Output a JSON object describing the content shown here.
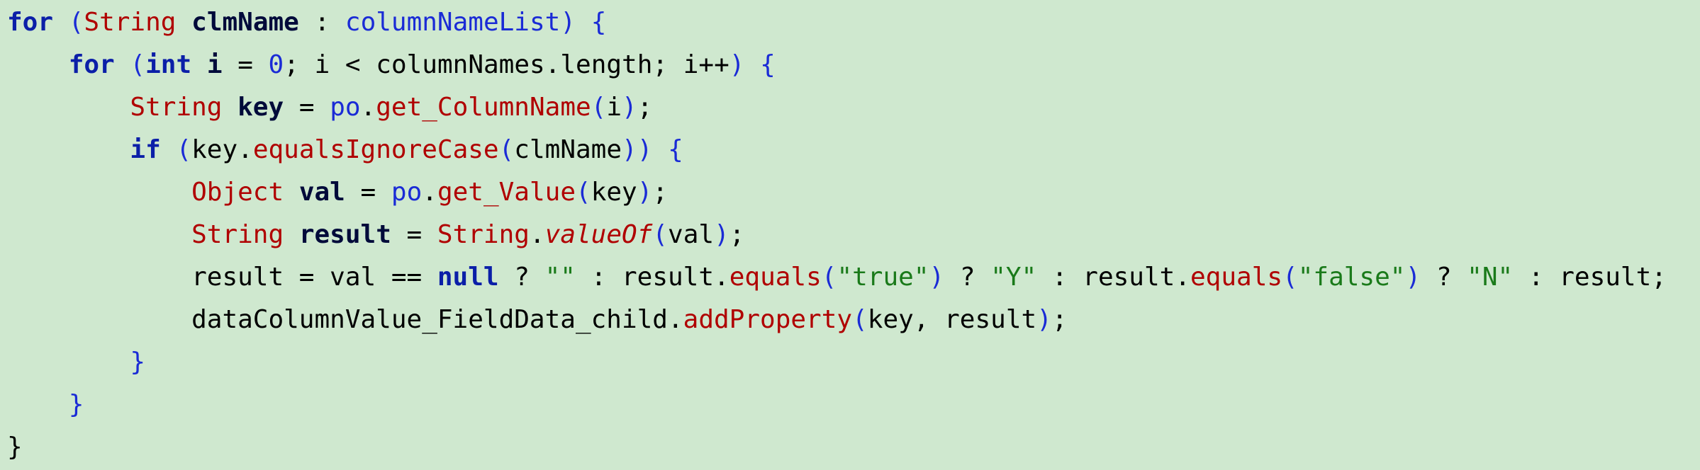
{
  "editor": {
    "lines": [
      [
        {
          "t": "for",
          "c": "kw"
        },
        {
          "t": " ",
          "c": "plain"
        },
        {
          "t": "(",
          "c": "paren"
        },
        {
          "t": "String",
          "c": "type"
        },
        {
          "t": " ",
          "c": "plain"
        },
        {
          "t": "clmName",
          "c": "bold"
        },
        {
          "t": " : ",
          "c": "plain"
        },
        {
          "t": "columnNameList",
          "c": "fld"
        },
        {
          "t": ")",
          "c": "paren"
        },
        {
          "t": " ",
          "c": "plain"
        },
        {
          "t": "{",
          "c": "brace"
        }
      ],
      [
        {
          "t": "    ",
          "c": "plain"
        },
        {
          "t": "for",
          "c": "kw"
        },
        {
          "t": " ",
          "c": "plain"
        },
        {
          "t": "(",
          "c": "paren"
        },
        {
          "t": "int",
          "c": "kw"
        },
        {
          "t": " ",
          "c": "plain"
        },
        {
          "t": "i",
          "c": "bold"
        },
        {
          "t": " = ",
          "c": "plain"
        },
        {
          "t": "0",
          "c": "num"
        },
        {
          "t": "; i < columnNames.length; i++",
          "c": "plain"
        },
        {
          "t": ")",
          "c": "paren"
        },
        {
          "t": " ",
          "c": "plain"
        },
        {
          "t": "{",
          "c": "brace"
        }
      ],
      [
        {
          "t": "        ",
          "c": "plain"
        },
        {
          "t": "String",
          "c": "type"
        },
        {
          "t": " ",
          "c": "plain"
        },
        {
          "t": "key",
          "c": "bold"
        },
        {
          "t": " = ",
          "c": "plain"
        },
        {
          "t": "po",
          "c": "fld"
        },
        {
          "t": ".",
          "c": "plain"
        },
        {
          "t": "get_ColumnName",
          "c": "meth"
        },
        {
          "t": "(",
          "c": "paren"
        },
        {
          "t": "i",
          "c": "plain"
        },
        {
          "t": ")",
          "c": "paren"
        },
        {
          "t": ";",
          "c": "plain"
        }
      ],
      [
        {
          "t": "        ",
          "c": "plain"
        },
        {
          "t": "if",
          "c": "kw"
        },
        {
          "t": " ",
          "c": "plain"
        },
        {
          "t": "(",
          "c": "paren"
        },
        {
          "t": "key.",
          "c": "plain"
        },
        {
          "t": "equalsIgnoreCase",
          "c": "meth"
        },
        {
          "t": "(",
          "c": "paren"
        },
        {
          "t": "clmName",
          "c": "plain"
        },
        {
          "t": "))",
          "c": "paren"
        },
        {
          "t": " ",
          "c": "plain"
        },
        {
          "t": "{",
          "c": "brace"
        }
      ],
      [
        {
          "t": "            ",
          "c": "plain"
        },
        {
          "t": "Object",
          "c": "type"
        },
        {
          "t": " ",
          "c": "plain"
        },
        {
          "t": "val",
          "c": "bold"
        },
        {
          "t": " = ",
          "c": "plain"
        },
        {
          "t": "po",
          "c": "fld"
        },
        {
          "t": ".",
          "c": "plain"
        },
        {
          "t": "get_Value",
          "c": "meth"
        },
        {
          "t": "(",
          "c": "paren"
        },
        {
          "t": "key",
          "c": "plain"
        },
        {
          "t": ")",
          "c": "paren"
        },
        {
          "t": ";",
          "c": "plain"
        }
      ],
      [
        {
          "t": "            ",
          "c": "plain"
        },
        {
          "t": "String",
          "c": "type"
        },
        {
          "t": " ",
          "c": "plain"
        },
        {
          "t": "result",
          "c": "bold"
        },
        {
          "t": " = ",
          "c": "plain"
        },
        {
          "t": "String",
          "c": "type"
        },
        {
          "t": ".",
          "c": "plain"
        },
        {
          "t": "valueOf",
          "c": "ital"
        },
        {
          "t": "(",
          "c": "paren"
        },
        {
          "t": "val",
          "c": "plain"
        },
        {
          "t": ")",
          "c": "paren"
        },
        {
          "t": ";",
          "c": "plain"
        }
      ],
      [
        {
          "t": "            ",
          "c": "plain"
        },
        {
          "t": "result = val == ",
          "c": "plain"
        },
        {
          "t": "null",
          "c": "kwn"
        },
        {
          "t": " ? ",
          "c": "plain"
        },
        {
          "t": "\"\"",
          "c": "str"
        },
        {
          "t": " : result.",
          "c": "plain"
        },
        {
          "t": "equals",
          "c": "meth"
        },
        {
          "t": "(",
          "c": "paren"
        },
        {
          "t": "\"true\"",
          "c": "str"
        },
        {
          "t": ")",
          "c": "paren"
        },
        {
          "t": " ? ",
          "c": "plain"
        },
        {
          "t": "\"Y\"",
          "c": "str"
        },
        {
          "t": " : result.",
          "c": "plain"
        },
        {
          "t": "equals",
          "c": "meth"
        },
        {
          "t": "(",
          "c": "paren"
        },
        {
          "t": "\"false\"",
          "c": "str"
        },
        {
          "t": ")",
          "c": "paren"
        },
        {
          "t": " ? ",
          "c": "plain"
        },
        {
          "t": "\"N\"",
          "c": "str"
        },
        {
          "t": " : result;",
          "c": "plain"
        }
      ],
      [
        {
          "t": "            ",
          "c": "plain"
        },
        {
          "t": "dataColumnValue_FieldData_child.",
          "c": "plain"
        },
        {
          "t": "addProperty",
          "c": "meth"
        },
        {
          "t": "(",
          "c": "paren"
        },
        {
          "t": "key, result",
          "c": "plain"
        },
        {
          "t": ")",
          "c": "paren"
        },
        {
          "t": ";",
          "c": "plain"
        }
      ],
      [
        {
          "t": "        ",
          "c": "plain"
        },
        {
          "t": "}",
          "c": "brace"
        }
      ],
      [
        {
          "t": "    ",
          "c": "plain"
        },
        {
          "t": "}",
          "c": "brace"
        }
      ],
      [
        {
          "t": "}",
          "c": "plain"
        }
      ]
    ]
  },
  "colors": {
    "background": "#cfe8cf",
    "keyword": "#0b1fa8",
    "type": "#b00000",
    "field": "#1a2bd6",
    "string": "#1a7a1a"
  }
}
